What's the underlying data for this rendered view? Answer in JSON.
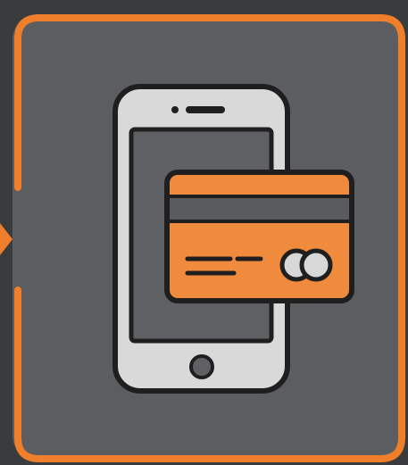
{
  "illustration": {
    "subject": "mobile-payment",
    "icons": [
      "phone-icon",
      "credit-card-icon",
      "contactless-chip-icon"
    ],
    "colors": {
      "background_outer": "#3a3b3d",
      "panel": "#5c5d60",
      "frame_accent": "#f07f2c",
      "phone_body": "#d9d9d9",
      "phone_outline": "#1f1f1f",
      "phone_screen": "#5f6063",
      "card_orange": "#f08a3c",
      "card_stripe": "#5a5b5e",
      "card_text_lines": "#1f1f1f",
      "chip_circles": "#d8d8d8"
    }
  }
}
